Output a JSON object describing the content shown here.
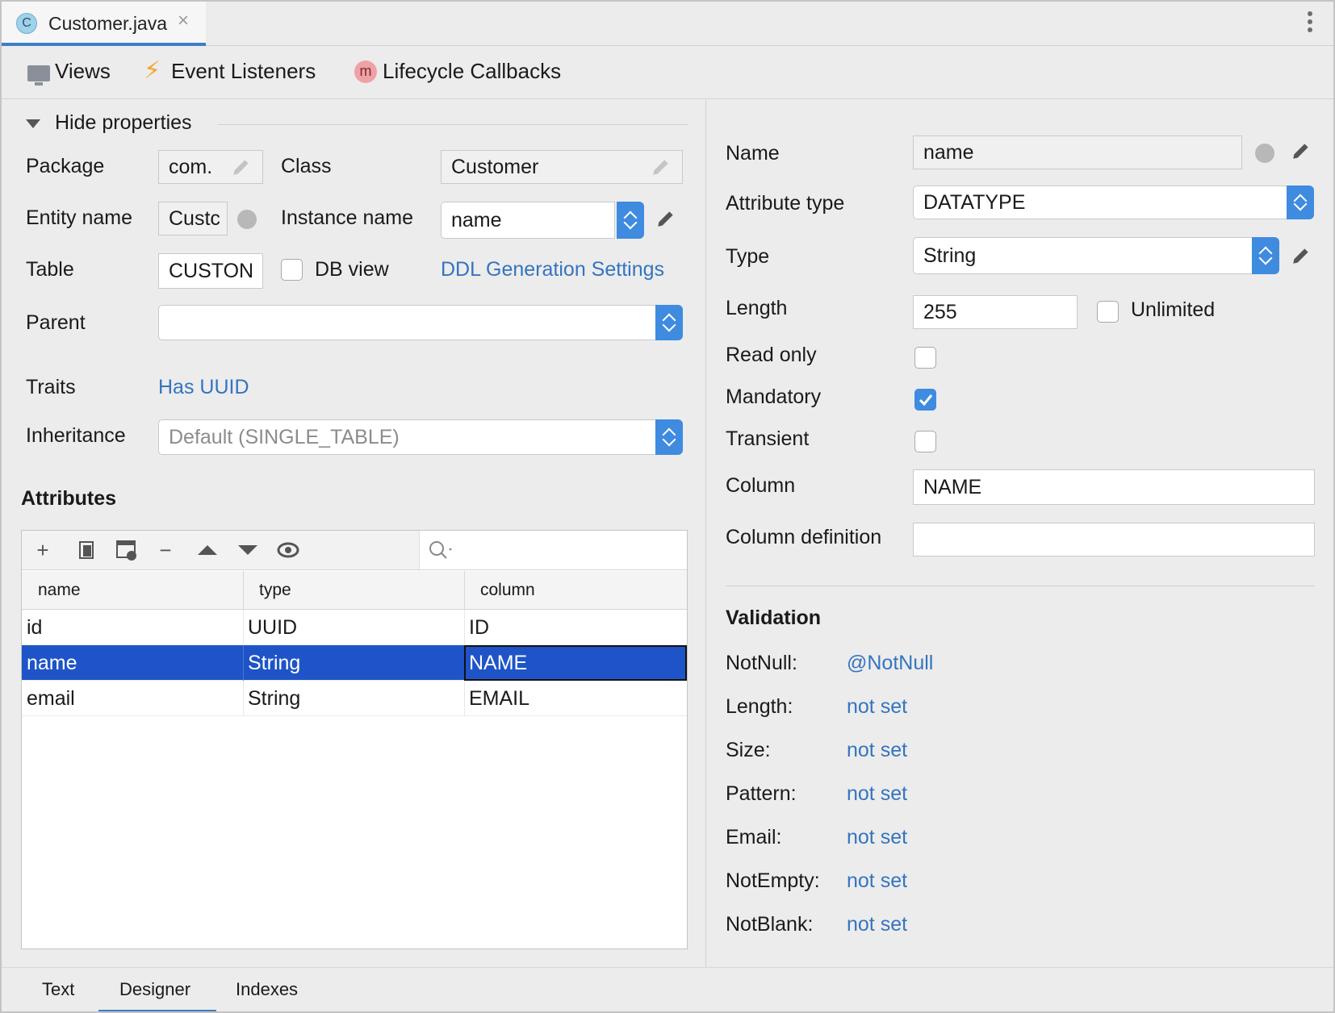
{
  "editor_tab": {
    "icon_letter": "C",
    "title": "Customer.java",
    "close_glyph": "×"
  },
  "toolbar": {
    "views_label": "Views",
    "event_listeners_label": "Event Listeners",
    "lifecycle_label": "Lifecycle Callbacks",
    "lifecycle_icon_letter": "m"
  },
  "properties": {
    "toggle_label": "Hide properties",
    "package_label": "Package",
    "package_value": "com.",
    "class_label": "Class",
    "class_value": "Customer",
    "entity_name_label": "Entity name",
    "entity_name_value": "Custc",
    "instance_name_label": "Instance name",
    "instance_name_value": "name",
    "table_label": "Table",
    "table_value": "CUSTON",
    "db_view_label": "DB view",
    "ddl_link": "DDL Generation Settings",
    "parent_label": "Parent",
    "parent_value": "",
    "traits_label": "Traits",
    "traits_link": "Has UUID",
    "inheritance_label": "Inheritance",
    "inheritance_value": "Default (SINGLE_TABLE)"
  },
  "attributes": {
    "heading": "Attributes",
    "tools": {
      "add": "+",
      "remove": "−"
    },
    "columns": [
      "name",
      "type",
      "column"
    ],
    "rows": [
      {
        "name": "id",
        "type": "UUID",
        "column": "ID"
      },
      {
        "name": "name",
        "type": "String",
        "column": "NAME"
      },
      {
        "name": "email",
        "type": "String",
        "column": "EMAIL"
      }
    ],
    "selected_row": 1
  },
  "attribute_details": {
    "name_label": "Name",
    "name_value": "name",
    "attribute_type_label": "Attribute type",
    "attribute_type_value": "DATATYPE",
    "type_label": "Type",
    "type_value": "String",
    "length_label": "Length",
    "length_value": "255",
    "unlimited_label": "Unlimited",
    "read_only_label": "Read only",
    "read_only_checked": false,
    "mandatory_label": "Mandatory",
    "mandatory_checked": true,
    "transient_label": "Transient",
    "transient_checked": false,
    "column_label": "Column",
    "column_value": "NAME",
    "column_definition_label": "Column definition",
    "column_definition_value": ""
  },
  "validation": {
    "heading": "Validation",
    "rules": [
      {
        "label": "NotNull:",
        "value": "@NotNull"
      },
      {
        "label": "Length:",
        "value": "not set"
      },
      {
        "label": "Size:",
        "value": "not set"
      },
      {
        "label": "Pattern:",
        "value": "not set"
      },
      {
        "label": "Email:",
        "value": "not set"
      },
      {
        "label": "NotEmpty:",
        "value": "not set"
      },
      {
        "label": "NotBlank:",
        "value": "not set"
      }
    ]
  },
  "bottom_tabs": {
    "text": "Text",
    "designer": "Designer",
    "indexes": "Indexes",
    "active": "Designer"
  },
  "colors": {
    "accent": "#3f8be0",
    "selection": "#1e54c7",
    "link": "#3474c0",
    "tab_underline": "#3d7ec9"
  }
}
